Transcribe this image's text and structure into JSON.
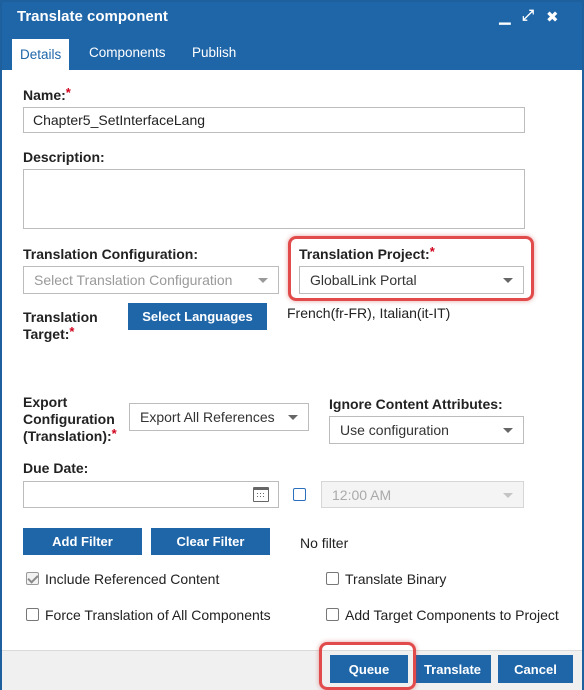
{
  "dialog": {
    "title": "Translate component",
    "controls": {
      "minimize": "▁",
      "maximize": "⤢",
      "close": "✖"
    }
  },
  "tabs": [
    {
      "label": "Details",
      "active": true
    },
    {
      "label": "Components",
      "active": false
    },
    {
      "label": "Publish",
      "active": false
    }
  ],
  "required_mark": "*",
  "form": {
    "name": {
      "label": "Name:",
      "value": "Chapter5_SetInterfaceLang"
    },
    "description": {
      "label": "Description:",
      "value": ""
    },
    "translation_configuration": {
      "label": "Translation Configuration:",
      "placeholder": "Select Translation Configuration"
    },
    "translation_project": {
      "label": "Translation Project:",
      "value": "GlobalLink Portal"
    },
    "translation_target": {
      "label_line1": "Translation",
      "label_line2": "Target:",
      "button": "Select Languages",
      "languages": "French(fr-FR), Italian(it-IT)"
    },
    "export_configuration": {
      "label_line1": "Export",
      "label_line2": "Configuration",
      "label_line3": "(Translation):",
      "value": "Export All References"
    },
    "ignore_content_attributes": {
      "label": "Ignore Content Attributes:",
      "value": "Use configuration"
    },
    "due_date": {
      "label": "Due Date:",
      "value": "",
      "time": "12:00 AM"
    },
    "filter": {
      "add_button": "Add Filter",
      "clear_button": "Clear Filter",
      "status": "No filter"
    },
    "options": {
      "include_referenced_content": {
        "label": "Include Referenced Content",
        "checked": true
      },
      "translate_binary": {
        "label": "Translate Binary",
        "checked": false
      },
      "force_translation": {
        "label": "Force Translation of All Components",
        "checked": false
      },
      "add_target_components": {
        "label": "Add Target Components to Project",
        "checked": false
      }
    }
  },
  "footer": {
    "queue": "Queue",
    "translate": "Translate",
    "cancel": "Cancel"
  },
  "colors": {
    "primary": "#1f66a9",
    "highlight": "#e24b4b",
    "required": "#d0021b"
  },
  "icons": {
    "calendar": "calendar-icon",
    "dropdown": "chevron-down-icon"
  }
}
